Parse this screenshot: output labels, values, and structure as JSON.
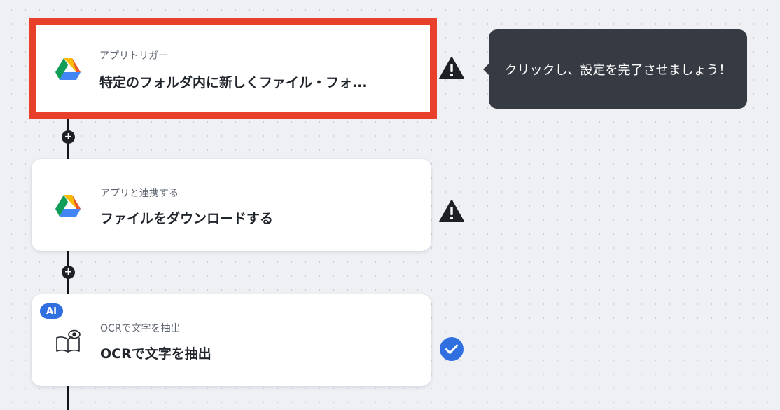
{
  "flow": {
    "steps": [
      {
        "subtitle": "アプリトリガー",
        "title": "特定のフォルダ内に新しくファイル・フォ...",
        "icon": "google-drive-icon",
        "status": "warning",
        "selected": true
      },
      {
        "subtitle": "アプリと連携する",
        "title": "ファイルをダウンロードする",
        "icon": "google-drive-icon",
        "status": "warning",
        "selected": false
      },
      {
        "subtitle": "OCRで文字を抽出",
        "title": "OCRで文字を抽出",
        "icon": "book-eye-icon",
        "status": "complete",
        "badge": "AI",
        "selected": false
      }
    ]
  },
  "tooltip": {
    "text": "クリックし、設定を完了させましょう！"
  },
  "colors": {
    "selection_border": "#e8402a",
    "ai_badge": "#2f6fe0",
    "check": "#2f6fe0",
    "warning": "#1d2025",
    "tooltip_bg": "#363a42",
    "line": "#111418"
  }
}
